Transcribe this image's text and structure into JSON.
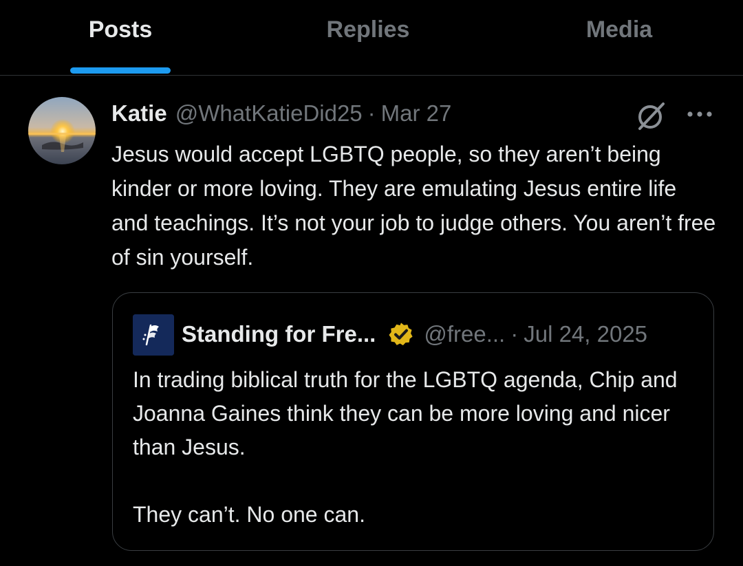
{
  "tabs": [
    {
      "label": "Posts",
      "active": true
    },
    {
      "label": "Replies",
      "active": false
    },
    {
      "label": "Media",
      "active": false
    }
  ],
  "post": {
    "display_name": "Katie",
    "handle": "@WhatKatieDid25",
    "separator": "·",
    "date": "Mar 27",
    "text": "Jesus would accept LGBTQ people, so they aren’t being kinder or more loving. They are emulating Jesus entire life and teachings. It’s not your job to judge others. You aren’t free of sin yourself.",
    "icons": [
      "grok-icon",
      "more-icon"
    ]
  },
  "quoted_post": {
    "display_name": "Standing for Fre...",
    "verified": "gold-check",
    "handle": "@free...",
    "separator": "·",
    "date": "Jul 24, 2025",
    "paragraphs": [
      "In trading biblical truth for the LGBTQ agenda, Chip and Joanna Gaines think they can be more loving and nicer than Jesus.",
      "They can’t. No one can."
    ]
  },
  "colors": {
    "background": "#000000",
    "text": "#e7e9ea",
    "muted": "#71767b",
    "accent": "#1d9bf0",
    "border": "#2f3336",
    "verified_gold": "#e2b719"
  }
}
